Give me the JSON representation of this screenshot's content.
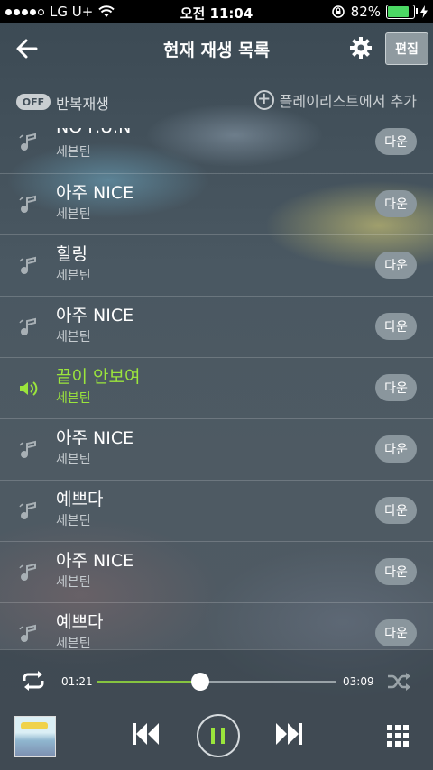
{
  "status_bar": {
    "carrier": "LG U+",
    "time": "오전 11:04",
    "battery_percent": "82%",
    "battery_level": 0.82
  },
  "header": {
    "title": "현재 재생 목록",
    "edit_label": "편집",
    "icons": [
      "back-arrow-icon",
      "gear-icon"
    ]
  },
  "subbar": {
    "repeat_toggle": "OFF",
    "repeat_label": "반복재생",
    "add_playlist_label": "플레이리스트에서 추가"
  },
  "playlist": [
    {
      "title": "NO F.U.N",
      "artist": "세븐틴",
      "download": "다운",
      "active": false
    },
    {
      "title": "아주 NICE",
      "artist": "세븐틴",
      "download": "다운",
      "active": false
    },
    {
      "title": "힐링",
      "artist": "세븐틴",
      "download": "다운",
      "active": false
    },
    {
      "title": "아주 NICE",
      "artist": "세븐틴",
      "download": "다운",
      "active": false
    },
    {
      "title": "끝이 안보여",
      "artist": "세븐틴",
      "download": "다운",
      "active": true
    },
    {
      "title": "아주 NICE",
      "artist": "세븐틴",
      "download": "다운",
      "active": false
    },
    {
      "title": "예쁘다",
      "artist": "세븐틴",
      "download": "다운",
      "active": false
    },
    {
      "title": "아주 NICE",
      "artist": "세븐틴",
      "download": "다운",
      "active": false
    },
    {
      "title": "예쁘다",
      "artist": "세븐틴",
      "download": "다운",
      "active": false
    }
  ],
  "player": {
    "elapsed": "01:21",
    "total": "03:09",
    "progress": 0.43
  },
  "colors": {
    "accent_green": "#9be53c",
    "progress_green": "#86c440"
  }
}
